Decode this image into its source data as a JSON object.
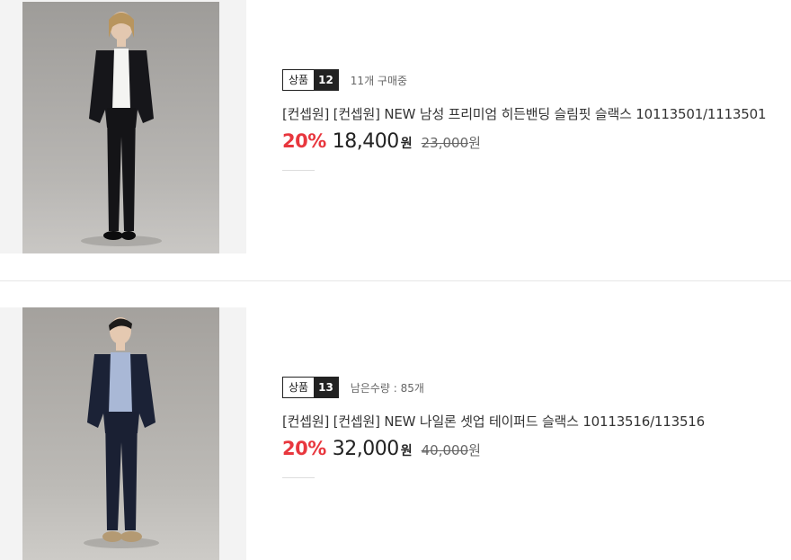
{
  "products": [
    {
      "badge_label": "상품",
      "badge_number": "12",
      "sub_text": "11개 구매중",
      "title": "[컨셉원] [컨셉원] NEW 남성 프리미엄 히든밴딩 슬림핏 슬랙스 10113501/1113501",
      "discount_rate": "20%",
      "price": "18,400",
      "price_unit": "원",
      "original_price": "23,000",
      "original_unit": "원",
      "image": "model-in-black-suit",
      "colors": {
        "suit": "#16161a",
        "shirt": "#f4f4f2"
      }
    },
    {
      "badge_label": "상품",
      "badge_number": "13",
      "sub_text": "남은수량 : 85개",
      "title": "[컨셉원] [컨셉원] NEW 나일론 셋업 테이퍼드 슬랙스 10113516/113516",
      "discount_rate": "20%",
      "price": "32,000",
      "price_unit": "원",
      "original_price": "40,000",
      "original_unit": "원",
      "image": "model-in-navy-suit",
      "colors": {
        "suit": "#1b2236",
        "shirt": "#a9b8d6"
      }
    }
  ],
  "accent_color": "#e8373e"
}
